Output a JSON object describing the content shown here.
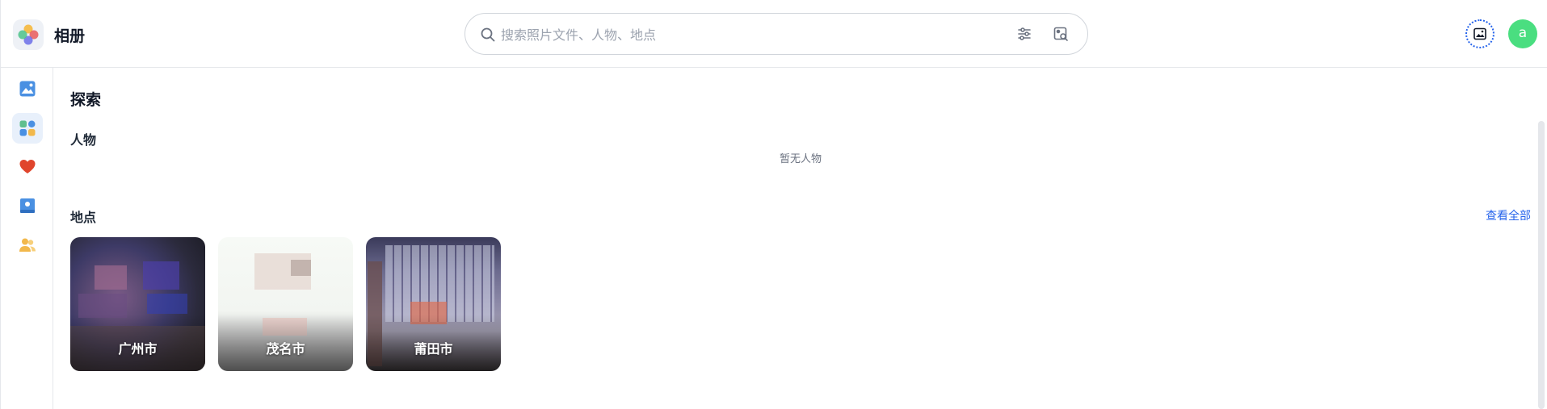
{
  "header": {
    "app_title": "相册",
    "search_placeholder": "搜索照片文件、人物、地点",
    "avatar_letter": "a"
  },
  "icons": {
    "logo": "photos-logo-icon",
    "search": "search-icon",
    "filter": "sliders-icon",
    "image_search": "image-search-icon",
    "upload": "image-upload-icon",
    "sidebar": [
      "photos-icon",
      "explore-icon",
      "heart-icon",
      "album-icon",
      "people-icon"
    ]
  },
  "colors": {
    "accent": "#2563eb",
    "avatar_bg": "#4ade80",
    "favorite": "#e0452c"
  },
  "main": {
    "page_title": "探索",
    "people": {
      "title": "人物",
      "empty_text": "暂无人物"
    },
    "places": {
      "title": "地点",
      "view_all": "查看全部",
      "items": [
        {
          "label": "广州市"
        },
        {
          "label": "茂名市"
        },
        {
          "label": "莆田市"
        }
      ]
    }
  }
}
